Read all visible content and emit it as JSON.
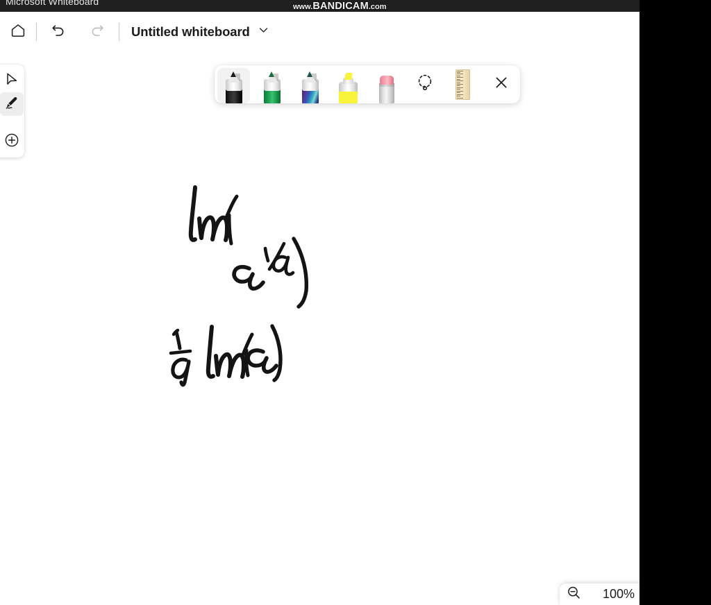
{
  "window": {
    "app_title": "Microsoft Whiteboard",
    "watermark_prefix": "www.",
    "watermark_brand": "BANDICAM",
    "watermark_suffix": ".com"
  },
  "header": {
    "home_label": "Home",
    "undo_label": "Undo",
    "redo_label": "Redo",
    "document_title": "Untitled whiteboard",
    "title_menu_label": "Open whiteboard menu"
  },
  "left_rail": {
    "items": [
      {
        "id": "select",
        "label": "Select",
        "icon": "cursor-arrow-icon",
        "selected": false
      },
      {
        "id": "ink",
        "label": "Ink",
        "icon": "pen-icon",
        "selected": true
      },
      {
        "id": "insert",
        "label": "Create",
        "icon": "plus-circle-icon",
        "selected": false
      }
    ]
  },
  "pen_toolbar": {
    "tools": [
      {
        "id": "pen-black",
        "label": "Black pen",
        "type": "pen",
        "color": "#161616",
        "selected": true
      },
      {
        "id": "pen-green",
        "label": "Green pen",
        "type": "pen",
        "color": "#17a34a",
        "selected": false
      },
      {
        "id": "pen-galaxy",
        "label": "Galaxy pen",
        "type": "pen",
        "color": "galaxy",
        "selected": false
      },
      {
        "id": "highlighter-yellow",
        "label": "Yellow highlighter",
        "type": "highlighter",
        "color": "#f7f43a",
        "selected": false
      },
      {
        "id": "eraser",
        "label": "Eraser",
        "type": "eraser",
        "color": "#f09aa8",
        "selected": false
      },
      {
        "id": "lasso",
        "label": "Lasso select",
        "type": "icon",
        "icon": "lasso-icon",
        "selected": false
      },
      {
        "id": "ruler",
        "label": "Ruler",
        "type": "ruler",
        "icon": "ruler-icon",
        "selected": false
      },
      {
        "id": "close",
        "label": "Close pen tray",
        "type": "icon",
        "icon": "close-icon",
        "selected": false
      }
    ]
  },
  "canvas": {
    "ink_color": "#141414",
    "strokes": [
      {
        "id": "line-1",
        "text": "ln(e^(1/a))"
      },
      {
        "id": "line-2",
        "text": "1/a ln(e)"
      }
    ]
  },
  "zoom": {
    "zoom_out_label": "Zoom out",
    "level": "100%"
  }
}
